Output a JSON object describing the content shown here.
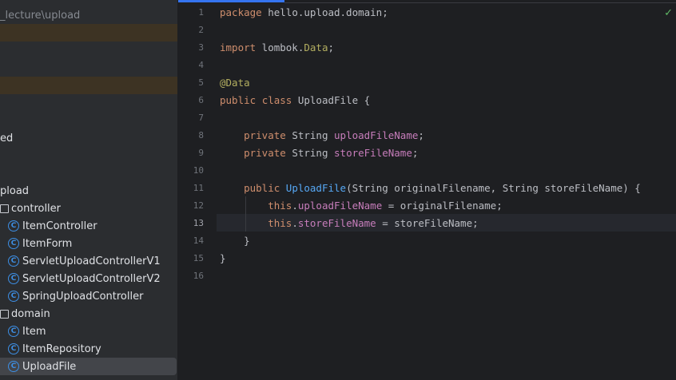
{
  "sidebar": {
    "rows": [
      {
        "text": "_lecture\\upload",
        "kind": "path",
        "icon": ""
      },
      {
        "text": "",
        "kind": "highlight",
        "icon": ""
      },
      {
        "text": "",
        "kind": "blank",
        "icon": ""
      },
      {
        "text": "",
        "kind": "blank",
        "icon": ""
      },
      {
        "text": "",
        "kind": "highlight",
        "icon": ""
      },
      {
        "text": "",
        "kind": "blank",
        "icon": ""
      },
      {
        "text": "",
        "kind": "blank",
        "icon": ""
      },
      {
        "text": "ed",
        "kind": "text",
        "icon": ""
      },
      {
        "text": "",
        "kind": "blank",
        "icon": ""
      },
      {
        "text": "",
        "kind": "blank",
        "icon": ""
      },
      {
        "text": "pload",
        "kind": "text",
        "icon": ""
      },
      {
        "text": "controller",
        "kind": "package",
        "icon": "folder-icon"
      },
      {
        "text": "ItemController",
        "kind": "class",
        "icon": "class-icon"
      },
      {
        "text": "ItemForm",
        "kind": "class",
        "icon": "class-icon"
      },
      {
        "text": "ServletUploadControllerV1",
        "kind": "class",
        "icon": "class-icon"
      },
      {
        "text": "ServletUploadControllerV2",
        "kind": "class",
        "icon": "class-icon"
      },
      {
        "text": "SpringUploadController",
        "kind": "class",
        "icon": "class-icon"
      },
      {
        "text": "domain",
        "kind": "package",
        "icon": "folder-icon"
      },
      {
        "text": "Item",
        "kind": "class",
        "icon": "class-icon"
      },
      {
        "text": "ItemRepository",
        "kind": "class",
        "icon": "class-icon"
      },
      {
        "text": "UploadFile",
        "kind": "class-selected",
        "icon": "class-icon"
      }
    ],
    "class_icon_letter": "C"
  },
  "editor": {
    "current_line": 13,
    "line_numbers": [
      "1",
      "2",
      "3",
      "4",
      "5",
      "6",
      "7",
      "8",
      "9",
      "10",
      "11",
      "12",
      "13",
      "14",
      "15",
      "16"
    ],
    "lines": [
      [
        {
          "t": "package",
          "c": "kw"
        },
        {
          "t": " hello.upload.domain;",
          "c": ""
        }
      ],
      [],
      [
        {
          "t": "import",
          "c": "kw"
        },
        {
          "t": " lombok.",
          "c": ""
        },
        {
          "t": "Data",
          "c": "ann2"
        },
        {
          "t": ";",
          "c": ""
        }
      ],
      [],
      [
        {
          "t": "@Data",
          "c": "ann"
        }
      ],
      [
        {
          "t": "public",
          "c": "kw"
        },
        {
          "t": " ",
          "c": ""
        },
        {
          "t": "class",
          "c": "kw"
        },
        {
          "t": " UploadFile {",
          "c": ""
        }
      ],
      [],
      [
        {
          "t": "    ",
          "c": ""
        },
        {
          "t": "private",
          "c": "kw"
        },
        {
          "t": " String ",
          "c": ""
        },
        {
          "t": "uploadFileName",
          "c": "fld"
        },
        {
          "t": ";",
          "c": ""
        }
      ],
      [
        {
          "t": "    ",
          "c": ""
        },
        {
          "t": "private",
          "c": "kw"
        },
        {
          "t": " String ",
          "c": ""
        },
        {
          "t": "storeFileName",
          "c": "fld"
        },
        {
          "t": ";",
          "c": ""
        }
      ],
      [],
      [
        {
          "t": "    ",
          "c": ""
        },
        {
          "t": "public",
          "c": "kw"
        },
        {
          "t": " ",
          "c": ""
        },
        {
          "t": "UploadFile",
          "c": "mth"
        },
        {
          "t": "(String originalFilename, String storeFileName) {",
          "c": ""
        }
      ],
      [
        {
          "t": "        ",
          "c": ""
        },
        {
          "t": "this",
          "c": "kw"
        },
        {
          "t": ".",
          "c": ""
        },
        {
          "t": "uploadFileName",
          "c": "fld"
        },
        {
          "t": " = originalFilename;",
          "c": ""
        }
      ],
      [
        {
          "t": "        ",
          "c": ""
        },
        {
          "t": "this",
          "c": "kw"
        },
        {
          "t": ".",
          "c": ""
        },
        {
          "t": "storeFileName",
          "c": "fld"
        },
        {
          "t": " = storeFileName;",
          "c": ""
        }
      ],
      [
        {
          "t": "    }",
          "c": ""
        }
      ],
      [
        {
          "t": "}",
          "c": ""
        }
      ],
      []
    ],
    "status_check": "✓",
    "colors": {
      "keyword": "#cf8e6d",
      "annotation": "#b3ae60",
      "field": "#c77dbb",
      "method": "#56a8f5",
      "text": "#bcbec4"
    }
  }
}
